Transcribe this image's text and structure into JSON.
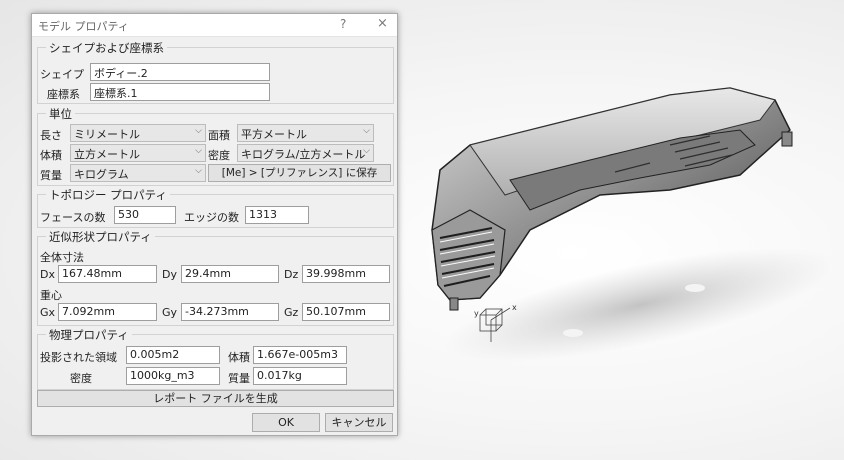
{
  "dialog": {
    "title": "モデル プロパティ",
    "help": "?",
    "close": "×",
    "shape_group": {
      "title": "シェイプおよび座標系",
      "shape_label": "シェイプ",
      "shape_value": "ボディー.2",
      "coord_label": "座標系",
      "coord_value": "座標系.1"
    },
    "units_group": {
      "title": "単位",
      "length_label": "長さ",
      "length_value": "ミリメートル",
      "area_label": "面積",
      "area_value": "平方メートル",
      "volume_label": "体積",
      "volume_value": "立方メートル",
      "density_label": "密度",
      "density_value": "キログラム/立方メートル",
      "mass_label": "質量",
      "mass_value": "キログラム",
      "preference_button": "[Me] > [プリファレンス] に保存"
    },
    "topology_group": {
      "title": "トポロジー プロパティ",
      "faces_label": "フェースの数",
      "faces_value": "530",
      "edges_label": "エッジの数",
      "edges_value": "1313"
    },
    "approx_group": {
      "title": "近似形状プロパティ",
      "overall_dims_label": "全体寸法",
      "dx_label": "Dx",
      "dx_value": "167.48mm",
      "dy_label": "Dy",
      "dy_value": "29.4mm",
      "dz_label": "Dz",
      "dz_value": "39.998mm",
      "cog_label": "重心",
      "gx_label": "Gx",
      "gx_value": "7.092mm",
      "gy_label": "Gy",
      "gy_value": "-34.273mm",
      "gz_label": "Gz",
      "gz_value": "50.107mm"
    },
    "physical_group": {
      "title": "物理プロパティ",
      "projected_area_label": "投影された領域",
      "projected_area_value": "0.005m2",
      "volume_label": "体積",
      "volume_value": "1.667e-005m3",
      "density_label": "密度",
      "density_value": "1000kg_m3",
      "mass_label": "質量",
      "mass_value": "0.017kg"
    },
    "report_button": "レポート ファイルを生成",
    "ok_button": "OK",
    "cancel_button": "キャンセル"
  },
  "viewport": {
    "axis_labels": {
      "x": "x",
      "y": "y"
    }
  }
}
